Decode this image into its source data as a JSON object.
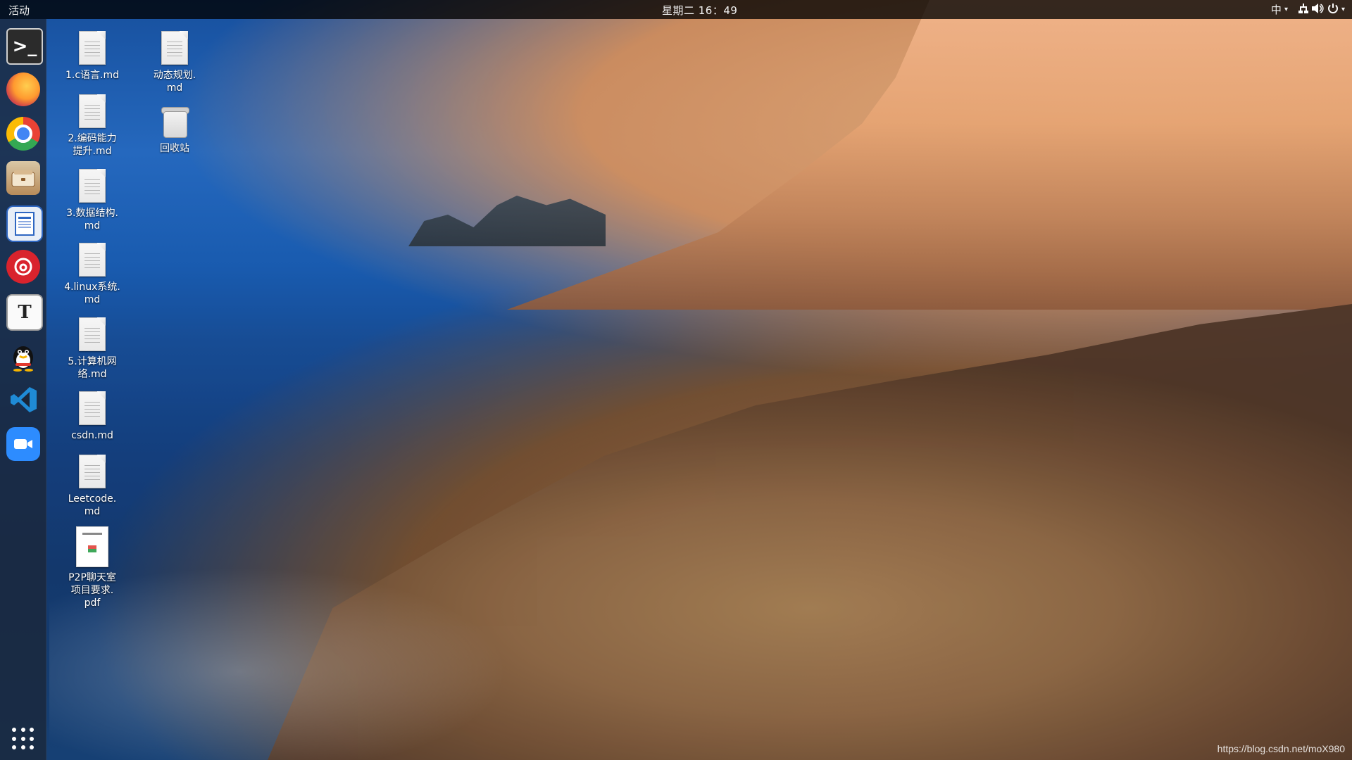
{
  "topbar": {
    "activities": "活动",
    "clock": "星期二 16：49",
    "input_method": "中",
    "icons": [
      "network-icon",
      "volume-icon",
      "power-icon"
    ]
  },
  "dock": {
    "items": [
      {
        "name": "terminal",
        "icon": "terminal-icon"
      },
      {
        "name": "firefox",
        "icon": "firefox-icon"
      },
      {
        "name": "chrome",
        "icon": "chrome-icon"
      },
      {
        "name": "files",
        "icon": "files-icon"
      },
      {
        "name": "writer",
        "icon": "document-writer-icon"
      },
      {
        "name": "netease-music",
        "icon": "music-icon"
      },
      {
        "name": "typora",
        "icon": "typora-icon"
      },
      {
        "name": "qq",
        "icon": "qq-icon"
      },
      {
        "name": "vscode",
        "icon": "vscode-icon"
      },
      {
        "name": "zoom",
        "icon": "video-meeting-icon"
      }
    ],
    "show_apps_icon": "apps-grid-icon"
  },
  "desktop": {
    "files": [
      {
        "label": "1.c语言.md"
      },
      {
        "label": "2.编码能力\n提升.md"
      },
      {
        "label": "3.数据结构.\nmd"
      },
      {
        "label": "4.linux系统.\nmd"
      },
      {
        "label": "5.计算机网\n络.md"
      },
      {
        "label": "csdn.md"
      },
      {
        "label": "Leetcode.\nmd"
      },
      {
        "label": "P2P聊天室\n项目要求.\npdf"
      },
      {
        "label": "动态规划.\nmd"
      },
      {
        "label": "回收站"
      }
    ]
  },
  "watermark": "https://blog.csdn.net/moX980"
}
